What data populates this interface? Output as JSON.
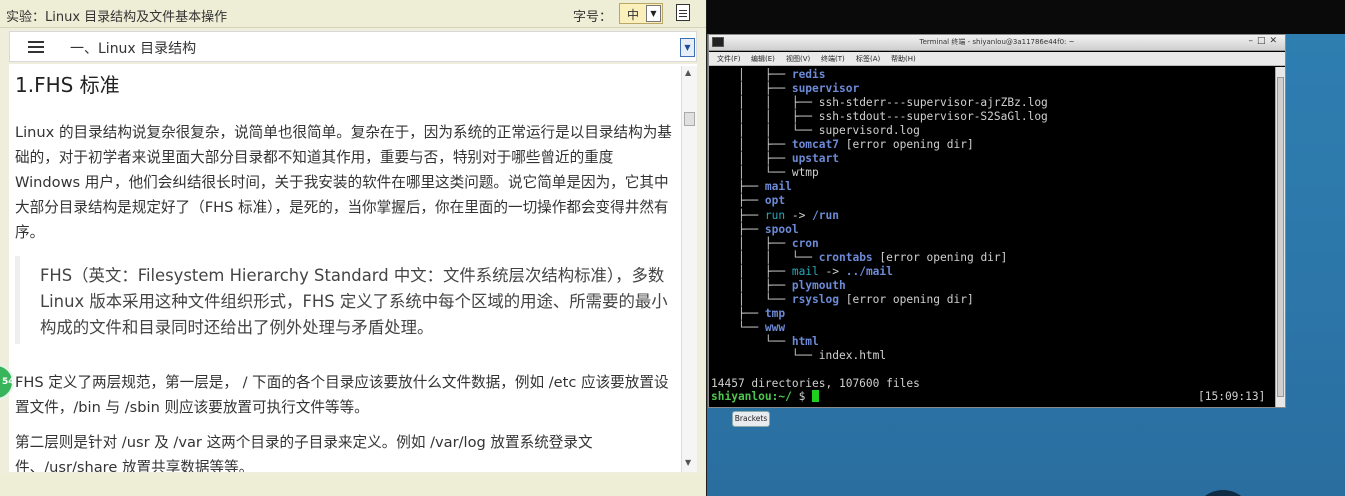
{
  "lab": {
    "title": "实验：Linux 目录结构及文件基本操作",
    "font_size_label": "字号：",
    "font_size_value": "中",
    "toc_title": "一、Linux 目录结构",
    "badge_text": "54"
  },
  "doc": {
    "heading": "1.FHS 标准",
    "para1": "Linux 的目录结构说复杂很复杂，说简单也很简单。复杂在于，因为系统的正常运行是以目录结构为基础的，对于初学者来说里面大部分目录都不知道其作用，重要与否，特别对于哪些曾近的重度 Windows 用户，他们会纠结很长时间，关于我安装的软件在哪里这类问题。说它简单是因为，它其中大部分目录结构是规定好了（FHS 标准），是死的，当你掌握后，你在里面的一切操作都会变得井然有序。",
    "quote": "FHS（英文：Filesystem Hierarchy Standard 中文：文件系统层次结构标准），多数 Linux 版本采用这种文件组织形式，FHS 定义了系统中每个区域的用途、所需要的最小构成的文件和目录同时还给出了例外处理与矛盾处理。",
    "para2": "FHS 定义了两层规范，第一层是， / 下面的各个目录应该要放什么文件数据，例如 /etc 应该要放置设置文件，/bin 与 /sbin 则应该要放置可执行文件等等。",
    "para3": "第二层则是针对 /usr 及 /var 这两个目录的子目录来定义。例如 /var/log 放置系统登录文件、/usr/share 放置共享数据等等。"
  },
  "terminal": {
    "title": "Terminal 终端 - shiyanlou@3a11786e44f0: ~",
    "menu": [
      "文件(F)",
      "编辑(E)",
      "视图(V)",
      "终端(T)",
      "标签(A)",
      "帮助(H)"
    ],
    "lines": [
      {
        "tree": "    │   ├── ",
        "name": "redis",
        "kind": "dir",
        "suffix": ""
      },
      {
        "tree": "    │   ├── ",
        "name": "supervisor",
        "kind": "dir",
        "suffix": ""
      },
      {
        "tree": "    │   │   ├── ",
        "name": "ssh-stderr---supervisor-ajrZBz.log",
        "kind": "norm",
        "suffix": ""
      },
      {
        "tree": "    │   │   ├── ",
        "name": "ssh-stdout---supervisor-S2SaGl.log",
        "kind": "norm",
        "suffix": ""
      },
      {
        "tree": "    │   │   └── ",
        "name": "supervisord.log",
        "kind": "norm",
        "suffix": ""
      },
      {
        "tree": "    │   ├── ",
        "name": "tomcat7",
        "kind": "dir",
        "suffix": " [error opening dir]"
      },
      {
        "tree": "    │   ├── ",
        "name": "upstart",
        "kind": "dir",
        "suffix": ""
      },
      {
        "tree": "    │   └── ",
        "name": "wtmp",
        "kind": "norm",
        "suffix": ""
      },
      {
        "tree": "    ├── ",
        "name": "mail",
        "kind": "dir",
        "suffix": ""
      },
      {
        "tree": "    ├── ",
        "name": "opt",
        "kind": "dir",
        "suffix": ""
      },
      {
        "tree": "    ├── ",
        "name": "run",
        "kind": "link",
        "suffix": " -> ",
        "target": "/run"
      },
      {
        "tree": "    ├── ",
        "name": "spool",
        "kind": "dir",
        "suffix": ""
      },
      {
        "tree": "    │   ├── ",
        "name": "cron",
        "kind": "dir",
        "suffix": ""
      },
      {
        "tree": "    │   │   └── ",
        "name": "crontabs",
        "kind": "dir",
        "suffix": " [error opening dir]"
      },
      {
        "tree": "    │   ├── ",
        "name": "mail",
        "kind": "link",
        "suffix": " -> ",
        "target": "../mail"
      },
      {
        "tree": "    │   ├── ",
        "name": "plymouth",
        "kind": "dir",
        "suffix": ""
      },
      {
        "tree": "    │   └── ",
        "name": "rsyslog",
        "kind": "dir",
        "suffix": " [error opening dir]"
      },
      {
        "tree": "    ├── ",
        "name": "tmp",
        "kind": "dir",
        "suffix": ""
      },
      {
        "tree": "    └── ",
        "name": "www",
        "kind": "dir",
        "suffix": ""
      },
      {
        "tree": "        └── ",
        "name": "html",
        "kind": "dir",
        "suffix": ""
      },
      {
        "tree": "            └── ",
        "name": "index.html",
        "kind": "norm",
        "suffix": ""
      },
      {
        "tree": "",
        "name": "",
        "kind": "norm",
        "suffix": ""
      },
      {
        "tree": "",
        "name": "14457 directories, 107600 files",
        "kind": "norm",
        "suffix": ""
      }
    ],
    "prompt_user": "shiyanlou:~/",
    "prompt_symbol": " $ ",
    "clock": "[15:09:13]"
  },
  "desktop": {
    "taskbar_button": "Brackets"
  }
}
